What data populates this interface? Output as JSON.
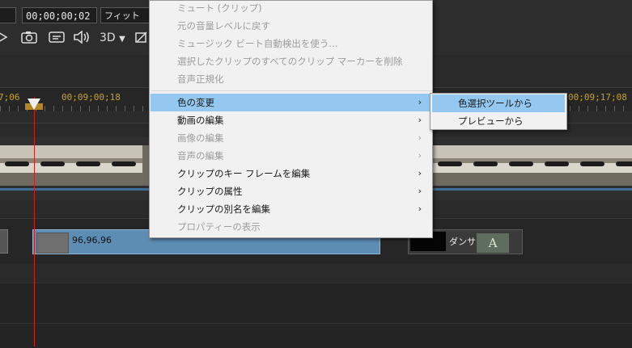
{
  "toolbar": {
    "timecode": "00;00;00;02",
    "fit_label": "フィット",
    "view_3d_label": "3D"
  },
  "ruler": {
    "left_label": "7;06",
    "mid_label": "00;09;00;18",
    "right_label": "00;09;17;08"
  },
  "context_menu": {
    "items": [
      {
        "label": "ミュート (クリップ)",
        "enabled": false,
        "submenu": false
      },
      {
        "label": "元の音量レベルに戻す",
        "enabled": false,
        "submenu": false
      },
      {
        "label": "ミュージック ビート自動検出を使う...",
        "enabled": false,
        "submenu": false
      },
      {
        "label": "選択したクリップのすべてのクリップ マーカーを削除",
        "enabled": false,
        "submenu": false
      },
      {
        "label": "音声正規化",
        "enabled": false,
        "submenu": false
      },
      {
        "label": "色の変更",
        "enabled": true,
        "submenu": true,
        "highlighted": true
      },
      {
        "label": "動画の編集",
        "enabled": true,
        "submenu": true
      },
      {
        "label": "画像の編集",
        "enabled": false,
        "submenu": true
      },
      {
        "label": "音声の編集",
        "enabled": false,
        "submenu": true
      },
      {
        "label": "クリップのキー フレームを編集",
        "enabled": true,
        "submenu": true
      },
      {
        "label": "クリップの属性",
        "enabled": true,
        "submenu": true
      },
      {
        "label": "クリップの別名を編集",
        "enabled": true,
        "submenu": true
      },
      {
        "label": "プロパティーの表示",
        "enabled": false,
        "submenu": false
      }
    ]
  },
  "color_submenu": {
    "items": [
      {
        "label": "色選択ツールから",
        "highlighted": true
      },
      {
        "label": "プレビューから",
        "highlighted": false
      }
    ]
  },
  "timeline": {
    "blue_clip_label": "96,96,96",
    "dark_clip_label": "ダンサー",
    "dark_clip_logo": "A",
    "blue_clip_color": "#5e8db3",
    "playhead_color": "#d12020"
  }
}
